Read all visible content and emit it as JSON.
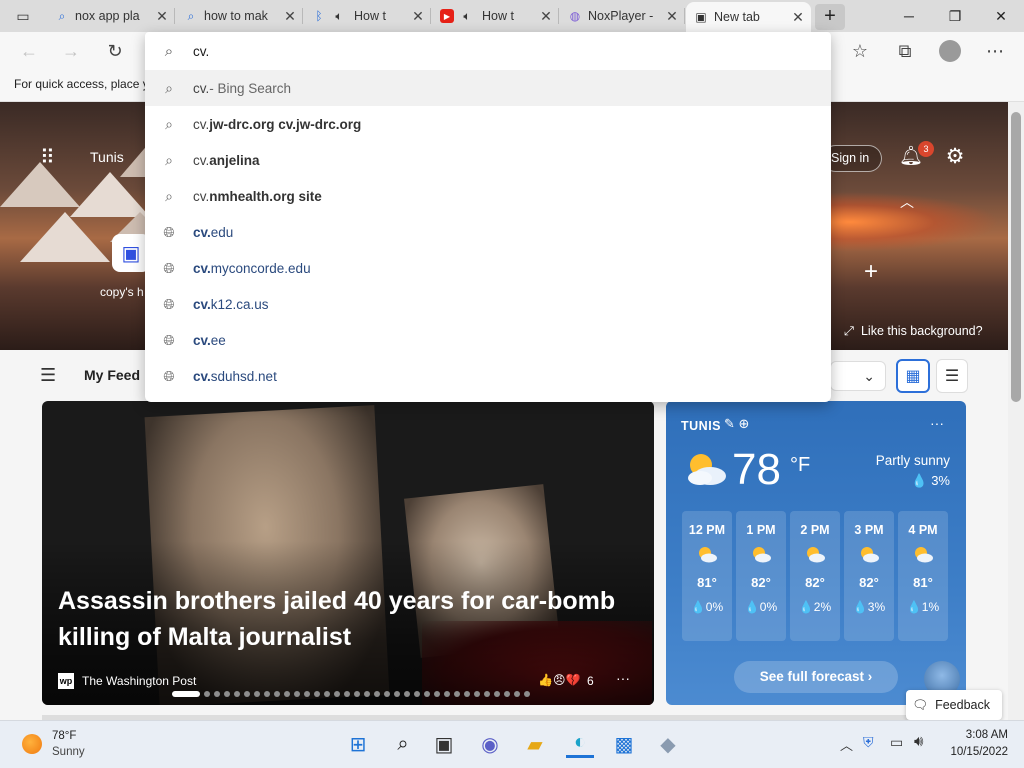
{
  "tabs": [
    {
      "icon": "search-icon",
      "title": "nox app pla",
      "icon_color": "#2c6fd9"
    },
    {
      "icon": "search-icon",
      "title": "how to mak",
      "icon_color": "#2c6fd9"
    },
    {
      "icon": "bing-icon",
      "title": "How t",
      "icon_color": "#2c6fd9",
      "audio": true
    },
    {
      "icon": "youtube-icon",
      "title": "How t",
      "icon_color": "#e62117",
      "audio": true
    },
    {
      "icon": "noxplayer-icon",
      "title": "NoxPlayer -",
      "icon_color": "#7b5bd6"
    },
    {
      "icon": "newtab-icon",
      "title": "New tab",
      "active": true
    }
  ],
  "window_controls": {
    "minimize": "─",
    "maximize": "❐",
    "close": "✕"
  },
  "address": {
    "value": "cv."
  },
  "favorites_bar": {
    "text": "For quick access, place y"
  },
  "suggestions": [
    {
      "type": "search",
      "prefix": "cv.",
      "rest": " - Bing Search"
    },
    {
      "type": "search",
      "prefix": "cv.",
      "rest": "jw-drc.org cv.jw-drc.org"
    },
    {
      "type": "search",
      "prefix": "cv.",
      "rest": " anjelina"
    },
    {
      "type": "search",
      "prefix": "cv.",
      "rest": "nmhealth.org site"
    },
    {
      "type": "site",
      "prefix": "cv.",
      "rest": "edu"
    },
    {
      "type": "site",
      "prefix": "cv.",
      "rest": "myconcorde.edu"
    },
    {
      "type": "site",
      "prefix": "cv.",
      "rest": "k12.ca.us"
    },
    {
      "type": "site",
      "prefix": "cv.",
      "rest": "ee"
    },
    {
      "type": "site",
      "prefix": "cv.",
      "rest": "sduhsd.net"
    }
  ],
  "hero": {
    "city": "Tunis",
    "app_tile_label": "copy's h",
    "sign_in": "Sign in",
    "notification_count": "3",
    "like_background": "Like this background?"
  },
  "feed": {
    "title": "My Feed"
  },
  "news": {
    "headline": "Assassin brothers jailed 40 years for car-bomb killing of Malta journalist",
    "source": "The Washington Post",
    "source_logo": "wp",
    "reactions": "👍😠💔",
    "reaction_count": "6",
    "more": "···",
    "carousel_active": 0,
    "carousel_count": 34
  },
  "weather": {
    "city": "TUNIS",
    "temp": "78",
    "unit": "°F",
    "condition": "Partly sunny",
    "precip": "💧 3%",
    "more": "···",
    "hours": [
      {
        "time": "12 PM",
        "temp": "81°",
        "precip": "💧0%"
      },
      {
        "time": "1 PM",
        "temp": "82°",
        "precip": "💧0%"
      },
      {
        "time": "2 PM",
        "temp": "82°",
        "precip": "💧2%"
      },
      {
        "time": "3 PM",
        "temp": "82°",
        "precip": "💧3%"
      },
      {
        "time": "4 PM",
        "temp": "81°",
        "precip": "💧1%"
      }
    ],
    "forecast_button": "See full forecast ›"
  },
  "feedback": "Feedback",
  "taskbar": {
    "weather_temp": "78°F",
    "weather_cond": "Sunny",
    "apps": [
      "windows-start-icon",
      "search-icon",
      "task-view-icon",
      "chat-icon",
      "file-explorer-icon",
      "edge-icon",
      "store-icon",
      "noxplayer-icon"
    ],
    "time": "3:08 AM",
    "date": "10/15/2022"
  }
}
